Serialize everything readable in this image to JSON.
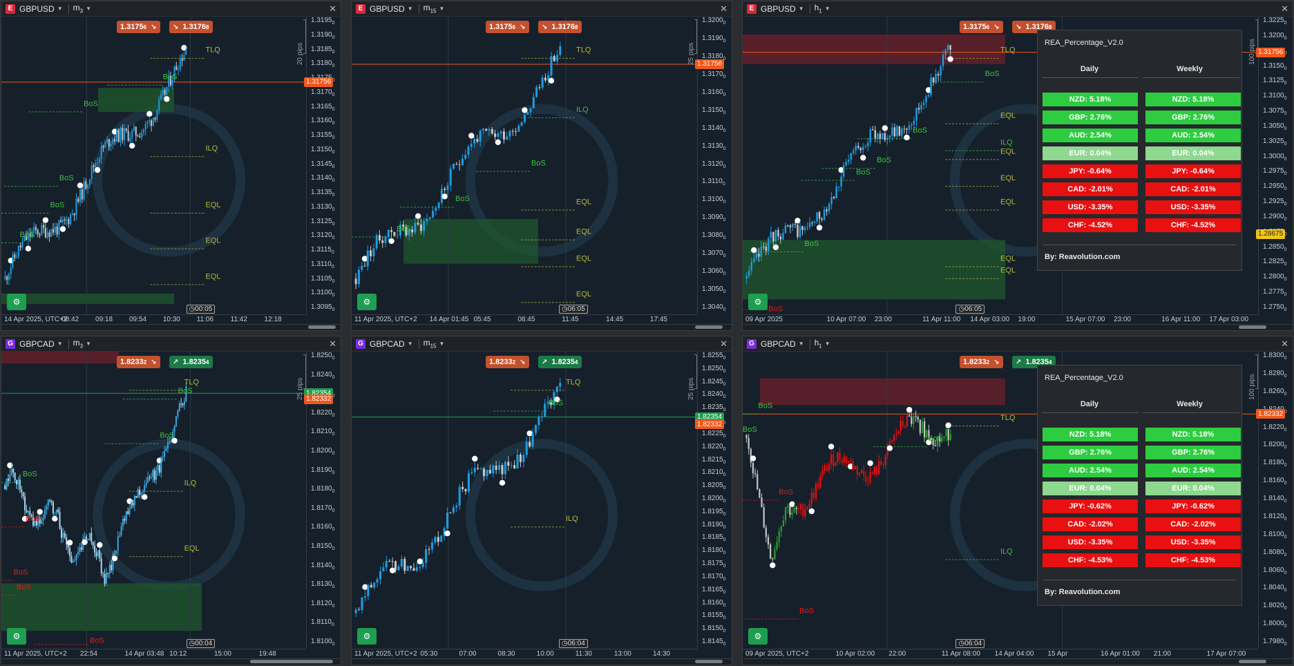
{
  "colors": {
    "bg": "#15202b",
    "bull": "#1e9ce0",
    "bear": "#c8c8c8",
    "red": "#e01c1c",
    "green": "#2eaa2e",
    "label_green": "#3fbf3f",
    "label_olive": "#b8b83a",
    "cell_green": "#2ecc40",
    "cell_lightgreen": "#8fd88f",
    "cell_red": "#e81010"
  },
  "panels": [
    {
      "id": "p1",
      "symbol": "GBPUSD",
      "badge": "E",
      "badge_color": "#d62b3b",
      "tf": "m",
      "tf_sub": "3",
      "bid": "1.3175",
      "bid_sub": "6",
      "ask": "1.3176",
      "ask_sub": "8",
      "ask_dir": "down",
      "pips": "20 pips",
      "y_ticks": [
        "1.3195",
        "1.3190",
        "1.3185",
        "1.3180",
        "1.3175",
        "1.3170",
        "1.3165",
        "1.3160",
        "1.3155",
        "1.3150",
        "1.3145",
        "1.3140",
        "1.3135",
        "1.3130",
        "1.3125",
        "1.3120",
        "1.3115",
        "1.3110",
        "1.3105",
        "1.3100",
        "1.3095"
      ],
      "y_subs": [
        "0",
        "0",
        "0",
        "0",
        "0",
        "0",
        "0",
        "0",
        "0",
        "0",
        "0",
        "0",
        "0",
        "0",
        "0",
        "0",
        "0",
        "0",
        "0",
        "0",
        "0"
      ],
      "price_tags": [
        {
          "text": "1.31756",
          "style": "orange",
          "frac": 0.22
        }
      ],
      "time_labels": [
        "14 Apr 2025, UTC+2",
        "08:42",
        "09:18",
        "09:54",
        "10:30",
        "11:06",
        "11:42",
        "12:18"
      ],
      "timer": "00:05",
      "labels": [
        {
          "t": "TLQ",
          "c": "olive",
          "x": 0.67,
          "y": 0.12
        },
        {
          "t": "BoS",
          "c": "green",
          "x": 0.53,
          "y": 0.21
        },
        {
          "t": "BoS",
          "c": "green",
          "x": 0.27,
          "y": 0.3
        },
        {
          "t": "ILQ",
          "c": "olive",
          "x": 0.67,
          "y": 0.45
        },
        {
          "t": "BoS",
          "c": "green",
          "x": 0.19,
          "y": 0.55
        },
        {
          "t": "BoS",
          "c": "green",
          "x": 0.16,
          "y": 0.64
        },
        {
          "t": "EQL",
          "c": "olive",
          "x": 0.67,
          "y": 0.64
        },
        {
          "t": "BoS",
          "c": "green",
          "x": 0.06,
          "y": 0.74
        },
        {
          "t": "EQL",
          "c": "olive",
          "x": 0.67,
          "y": 0.76
        },
        {
          "t": "EQL",
          "c": "olive",
          "x": 0.67,
          "y": 0.88
        }
      ],
      "trend": "up",
      "seed": 11,
      "candles": 95,
      "ind": null
    },
    {
      "id": "p2",
      "symbol": "GBPUSD",
      "badge": "E",
      "badge_color": "#d62b3b",
      "tf": "m",
      "tf_sub": "15",
      "bid": "1.3175",
      "bid_sub": "6",
      "ask": "1.3176",
      "ask_sub": "8",
      "ask_dir": "down",
      "pips": "25 pips",
      "y_ticks": [
        "1.3200",
        "1.3190",
        "1.3180",
        "1.3170",
        "1.3160",
        "1.3150",
        "1.3140",
        "1.3130",
        "1.3120",
        "1.3110",
        "1.3100",
        "1.3090",
        "1.3080",
        "1.3070",
        "1.3060",
        "1.3050",
        "1.3040"
      ],
      "y_subs": [
        "0",
        "0",
        "0",
        "0",
        "0",
        "0",
        "0",
        "0",
        "0",
        "0",
        "0",
        "0",
        "0",
        "0",
        "0",
        "0",
        "0"
      ],
      "price_tags": [
        {
          "text": "1.31756",
          "style": "orange",
          "frac": 0.16
        }
      ],
      "time_labels": [
        "11 Apr 2025, UTC+2",
        "14 Apr 01:45",
        "05:45",
        "08:45",
        "11:45",
        "14:45",
        "17:45"
      ],
      "timer": "06:05",
      "labels": [
        {
          "t": "TLQ",
          "c": "olive",
          "x": 0.65,
          "y": 0.12
        },
        {
          "t": "ILQ",
          "c": "green",
          "x": 0.65,
          "y": 0.32
        },
        {
          "t": "BoS",
          "c": "green",
          "x": 0.52,
          "y": 0.5
        },
        {
          "t": "BoS",
          "c": "green",
          "x": 0.3,
          "y": 0.62
        },
        {
          "t": "EQL",
          "c": "olive",
          "x": 0.65,
          "y": 0.63
        },
        {
          "t": "BoS",
          "c": "green",
          "x": 0.13,
          "y": 0.72
        },
        {
          "t": "EQL",
          "c": "olive",
          "x": 0.65,
          "y": 0.73
        },
        {
          "t": "EQL",
          "c": "olive",
          "x": 0.65,
          "y": 0.82
        },
        {
          "t": "EQL",
          "c": "olive",
          "x": 0.65,
          "y": 0.94
        }
      ],
      "trend": "up",
      "seed": 23,
      "candles": 70,
      "ind": null
    },
    {
      "id": "p3",
      "symbol": "GBPUSD",
      "badge": "E",
      "badge_color": "#d62b3b",
      "tf": "h",
      "tf_sub": "1",
      "bid": "1.3175",
      "bid_sub": "6",
      "ask": "1.3176",
      "ask_sub": "8",
      "ask_dir": "down",
      "pips": "100 pips",
      "y_ticks": [
        "1.3225",
        "1.3200",
        "1.3175",
        "1.3150",
        "1.3125",
        "1.3100",
        "1.3075",
        "1.3050",
        "1.3025",
        "1.3000",
        "1.2975",
        "1.2950",
        "1.2925",
        "1.2900",
        "1.2875",
        "1.2850",
        "1.2825",
        "1.2800",
        "1.2775",
        "1.2750"
      ],
      "y_subs": [
        "0",
        "0",
        "0",
        "0",
        "0",
        "0",
        "0",
        "0",
        "0",
        "0",
        "0",
        "0",
        "0",
        "0",
        "0",
        "0",
        "0",
        "0",
        "0",
        "0"
      ],
      "price_tags": [
        {
          "text": "1.31756",
          "style": "orange",
          "frac": 0.12
        },
        {
          "text": "1.28675",
          "style": "yellow",
          "frac": 0.73
        }
      ],
      "time_labels": [
        "09 Apr 2025",
        "10 Apr 07:00",
        "23:00",
        "11 Apr 11:00",
        "14 Apr 03:00",
        "19:00",
        "15 Apr 07:00",
        "23:00",
        "16 Apr 11:00",
        "17 Apr 03:00"
      ],
      "timer": "06:05",
      "labels": [
        {
          "t": "TLQ",
          "c": "olive",
          "x": 0.5,
          "y": 0.12
        },
        {
          "t": "BoS",
          "c": "green",
          "x": 0.47,
          "y": 0.2
        },
        {
          "t": "EQL",
          "c": "olive",
          "x": 0.5,
          "y": 0.34
        },
        {
          "t": "BoS",
          "c": "green",
          "x": 0.33,
          "y": 0.39
        },
        {
          "t": "ILQ",
          "c": "green",
          "x": 0.5,
          "y": 0.43
        },
        {
          "t": "EQL",
          "c": "olive",
          "x": 0.5,
          "y": 0.46
        },
        {
          "t": "BoS",
          "c": "green",
          "x": 0.26,
          "y": 0.49
        },
        {
          "t": "EQL",
          "c": "olive",
          "x": 0.5,
          "y": 0.55
        },
        {
          "t": "BoS",
          "c": "green",
          "x": 0.22,
          "y": 0.53
        },
        {
          "t": "EQL",
          "c": "olive",
          "x": 0.5,
          "y": 0.63
        },
        {
          "t": "BoS",
          "c": "green",
          "x": 0.12,
          "y": 0.77
        },
        {
          "t": "EQL",
          "c": "olive",
          "x": 0.5,
          "y": 0.82
        },
        {
          "t": "EQL",
          "c": "olive",
          "x": 0.5,
          "y": 0.86
        },
        {
          "t": "BoS",
          "c": "red",
          "x": 0.05,
          "y": 0.99
        }
      ],
      "trend": "up",
      "seed": 37,
      "candles": 85,
      "ind": {
        "title": "REA_Percentage_V2.0",
        "daily_h": "Daily",
        "weekly_h": "Weekly",
        "rows": [
          {
            "t": "NZD: 5.18%",
            "k": "g"
          },
          {
            "t": "GBP: 2.76%",
            "k": "g"
          },
          {
            "t": "AUD: 2.54%",
            "k": "g"
          },
          {
            "t": "EUR: 0.04%",
            "k": "lg"
          },
          {
            "t": "JPY: -0.64%",
            "k": "r"
          },
          {
            "t": "CAD: -2.01%",
            "k": "r"
          },
          {
            "t": "USD: -3.35%",
            "k": "r"
          },
          {
            "t": "CHF: -4.52%",
            "k": "r"
          }
        ],
        "weekly_rows": [
          {
            "t": "NZD: 5.18%",
            "k": "g"
          },
          {
            "t": "GBP: 2.76%",
            "k": "g"
          },
          {
            "t": "AUD: 2.54%",
            "k": "g"
          },
          {
            "t": "EUR: 0.04%",
            "k": "lg"
          },
          {
            "t": "JPY: -0.64%",
            "k": "r"
          },
          {
            "t": "CAD: -2.01%",
            "k": "r"
          },
          {
            "t": "USD: -3.35%",
            "k": "r"
          },
          {
            "t": "CHF: -4.52%",
            "k": "r"
          }
        ],
        "footer": "By: Reavolution.com"
      }
    },
    {
      "id": "p4",
      "symbol": "GBPCAD",
      "badge": "G",
      "badge_color": "#7b2be0",
      "tf": "m",
      "tf_sub": "3",
      "bid": "1.8233",
      "bid_sub": "2",
      "ask": "1.8235",
      "ask_sub": "4",
      "ask_dir": "up",
      "pips": "25 pips",
      "y_ticks": [
        "1.8250",
        "1.8240",
        "1.8230",
        "1.8220",
        "1.8210",
        "1.8200",
        "1.8190",
        "1.8180",
        "1.8170",
        "1.8160",
        "1.8150",
        "1.8140",
        "1.8130",
        "1.8120",
        "1.8110",
        "1.8100"
      ],
      "y_subs": [
        "0",
        "0",
        "0",
        "0",
        "0",
        "0",
        "0",
        "0",
        "0",
        "0",
        "0",
        "0",
        "0",
        "0",
        "0",
        "0"
      ],
      "price_tags": [
        {
          "text": "1.82354",
          "style": "green",
          "frac": 0.14
        },
        {
          "text": "1.82332",
          "style": "orange",
          "frac": 0.16
        }
      ],
      "time_labels": [
        "11 Apr 2025, UTC+2",
        "22:54",
        "14 Apr 03:48",
        "10:12",
        "15:00",
        "19:48"
      ],
      "timer": "00:04",
      "labels": [
        {
          "t": "TLQ",
          "c": "olive",
          "x": 0.6,
          "y": 0.11
        },
        {
          "t": "BoS",
          "c": "green",
          "x": 0.58,
          "y": 0.14
        },
        {
          "t": "BoS",
          "c": "green",
          "x": 0.52,
          "y": 0.29
        },
        {
          "t": "ILQ",
          "c": "olive",
          "x": 0.6,
          "y": 0.45
        },
        {
          "t": "BoS",
          "c": "green",
          "x": 0.07,
          "y": 0.42
        },
        {
          "t": "BoS",
          "c": "red",
          "x": 0.08,
          "y": 0.57
        },
        {
          "t": "EQL",
          "c": "olive",
          "x": 0.6,
          "y": 0.67
        },
        {
          "t": "BoS",
          "c": "red",
          "x": 0.04,
          "y": 0.75
        },
        {
          "t": "BoS",
          "c": "red",
          "x": 0.05,
          "y": 0.8
        },
        {
          "t": "BoS",
          "c": "red",
          "x": 0.29,
          "y": 0.98
        }
      ],
      "trend": "v",
      "seed": 51,
      "candles": 110,
      "ind": null
    },
    {
      "id": "p5",
      "symbol": "GBPCAD",
      "badge": "G",
      "badge_color": "#7b2be0",
      "tf": "m",
      "tf_sub": "15",
      "bid": "1.8233",
      "bid_sub": "2",
      "ask": "1.8235",
      "ask_sub": "4",
      "ask_dir": "up",
      "pips": "25 pips",
      "y_ticks": [
        "1.8255",
        "1.8250",
        "1.8245",
        "1.8240",
        "1.8235",
        "1.8230",
        "1.8225",
        "1.8220",
        "1.8215",
        "1.8210",
        "1.8205",
        "1.8200",
        "1.8195",
        "1.8190",
        "1.8185",
        "1.8180",
        "1.8175",
        "1.8170",
        "1.8165",
        "1.8160",
        "1.8155",
        "1.8150",
        "1.8145"
      ],
      "y_subs": [
        "0",
        "0",
        "0",
        "0",
        "0",
        "0",
        "0",
        "0",
        "0",
        "0",
        "0",
        "0",
        "0",
        "0",
        "0",
        "0",
        "0",
        "0",
        "0",
        "0",
        "0",
        "0",
        "0"
      ],
      "price_tags": [
        {
          "text": "1.82354",
          "style": "green",
          "frac": 0.22
        },
        {
          "text": "1.82332",
          "style": "orange",
          "frac": 0.245
        }
      ],
      "time_labels": [
        "11 Apr 2025, UTC+2",
        "05:30",
        "07:00",
        "08:30",
        "10:00",
        "11:30",
        "13:00",
        "14:30"
      ],
      "timer": "06:04",
      "labels": [
        {
          "t": "TLQ",
          "c": "olive",
          "x": 0.62,
          "y": 0.11
        },
        {
          "t": "BoS",
          "c": "green",
          "x": 0.57,
          "y": 0.18
        },
        {
          "t": "ILQ",
          "c": "olive",
          "x": 0.62,
          "y": 0.57
        }
      ],
      "trend": "up",
      "seed": 63,
      "candles": 68,
      "ind": null
    },
    {
      "id": "p6",
      "symbol": "GBPCAD",
      "badge": "G",
      "badge_color": "#7b2be0",
      "tf": "h",
      "tf_sub": "1",
      "bid": "1.8233",
      "bid_sub": "2",
      "ask": "1.8235",
      "ask_sub": "4",
      "ask_dir": "up",
      "pips": "100 pips",
      "y_ticks": [
        "1.8300",
        "1.8280",
        "1.8260",
        "1.8240",
        "1.8220",
        "1.8200",
        "1.8180",
        "1.8160",
        "1.8140",
        "1.8120",
        "1.8100",
        "1.8080",
        "1.8060",
        "1.8040",
        "1.8020",
        "1.8000",
        "1.7980"
      ],
      "y_subs": [
        "0",
        "0",
        "0",
        "0",
        "0",
        "0",
        "0",
        "0",
        "0",
        "0",
        "0",
        "0",
        "0",
        "0",
        "0",
        "0",
        "0"
      ],
      "price_tags": [
        {
          "text": "1.82332",
          "style": "orange",
          "frac": 0.21
        }
      ],
      "time_labels": [
        "09 Apr 2025, UTC+2",
        "10 Apr 02:00",
        "22:00",
        "11 Apr 08:00",
        "14 Apr 04:00",
        "15 Apr",
        "16 Apr 01:00",
        "21:00",
        "17 Apr 07:00"
      ],
      "timer": "06:04",
      "labels": [
        {
          "t": "BoS",
          "c": "green",
          "x": 0.03,
          "y": 0.19
        },
        {
          "t": "TLQ",
          "c": "olive",
          "x": 0.5,
          "y": 0.23
        },
        {
          "t": "BoS",
          "c": "green",
          "x": 0.0,
          "y": 0.27
        },
        {
          "t": "BoS",
          "c": "green",
          "x": 0.36,
          "y": 0.3
        },
        {
          "t": "BoS",
          "c": "red",
          "x": 0.07,
          "y": 0.48
        },
        {
          "t": "ILQ",
          "c": "green",
          "x": 0.5,
          "y": 0.68
        },
        {
          "t": "BoS",
          "c": "red",
          "x": 0.11,
          "y": 0.88
        }
      ],
      "trend": "v6",
      "seed": 77,
      "candles": 95,
      "ind": {
        "title": "REA_Percentage_V2.0",
        "daily_h": "Daily",
        "weekly_h": "Weekly",
        "rows": [
          {
            "t": "NZD: 5.18%",
            "k": "g"
          },
          {
            "t": "GBP: 2.76%",
            "k": "g"
          },
          {
            "t": "AUD: 2.54%",
            "k": "g"
          },
          {
            "t": "EUR: 0.04%",
            "k": "lg"
          },
          {
            "t": "JPY: -0.62%",
            "k": "r"
          },
          {
            "t": "CAD: -2.02%",
            "k": "r"
          },
          {
            "t": "USD: -3.35%",
            "k": "r"
          },
          {
            "t": "CHF: -4.53%",
            "k": "r"
          }
        ],
        "weekly_rows": [
          {
            "t": "NZD: 5.18%",
            "k": "g"
          },
          {
            "t": "GBP: 2.76%",
            "k": "g"
          },
          {
            "t": "AUD: 2.54%",
            "k": "g"
          },
          {
            "t": "EUR: 0.04%",
            "k": "lg"
          },
          {
            "t": "JPY: -0.62%",
            "k": "r"
          },
          {
            "t": "CAD: -2.02%",
            "k": "r"
          },
          {
            "t": "USD: -3.35%",
            "k": "r"
          },
          {
            "t": "CHF: -4.53%",
            "k": "r"
          }
        ],
        "footer": "By: Reavolution.com"
      }
    }
  ]
}
